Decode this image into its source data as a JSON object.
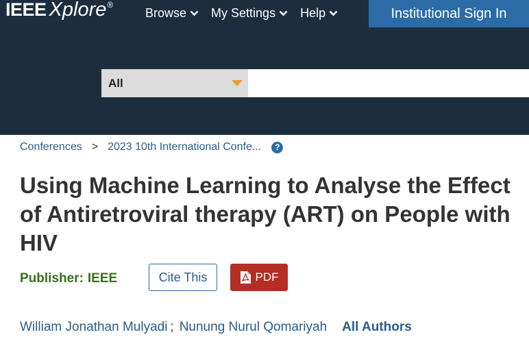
{
  "header": {
    "logo_main": "IEEE",
    "logo_sub": "Xplore",
    "logo_reg": "®",
    "nav": [
      {
        "label": "Browse"
      },
      {
        "label": "My Settings"
      },
      {
        "label": "Help"
      }
    ],
    "signin_label": "Institutional Sign In"
  },
  "search": {
    "select_value": "All",
    "input_value": "",
    "placeholder": ""
  },
  "breadcrumb": {
    "items": [
      "Conferences",
      "2023 10th International Confe..."
    ],
    "separator": ">",
    "help_icon_glyph": "?"
  },
  "article": {
    "title": "Using Machine Learning to Analyse the Effect of Antiretroviral therapy (ART) on People with HIV",
    "publisher_label": "Publisher:",
    "publisher_value": "IEEE",
    "cite_label": "Cite This",
    "pdf_label": "PDF",
    "authors": [
      "William Jonathan Mulyadi",
      "Nunung Nurul Qomariyah"
    ],
    "author_separator": ";",
    "all_authors_label": "All Authors"
  },
  "colors": {
    "header_bg": "#1c2d3e",
    "signin_bg": "#2b6ca8",
    "link": "#2b5c8a",
    "publisher_green": "#3a6e1e",
    "pdf_red": "#b32e25",
    "caret": "#e5a030"
  },
  "icons": [
    "chevron-down-icon",
    "caret-down-icon",
    "help-icon",
    "pdf-icon"
  ]
}
